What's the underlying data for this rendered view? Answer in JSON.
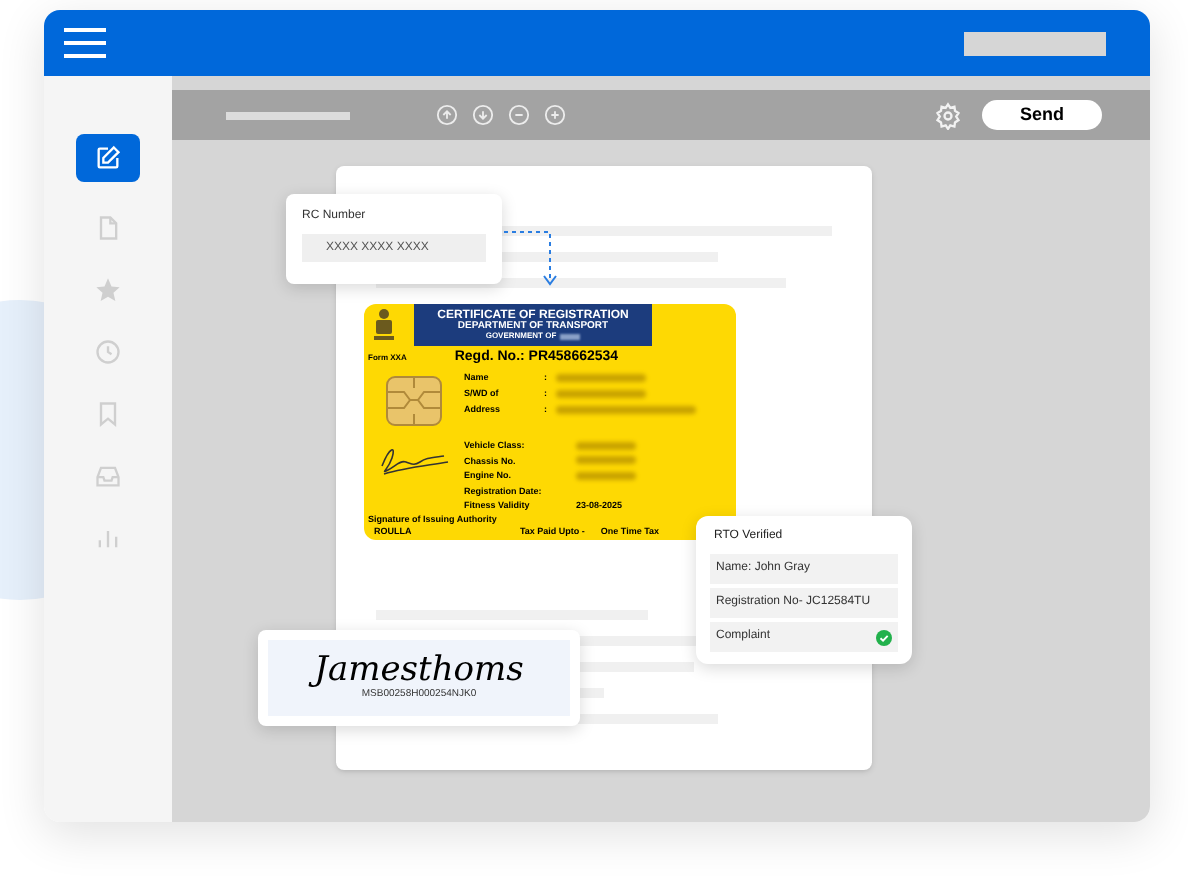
{
  "toolbar": {
    "send_button": "Send"
  },
  "sidebar": {
    "items": [
      {
        "kind": "edit",
        "selected": true
      },
      {
        "kind": "file",
        "selected": false
      },
      {
        "kind": "star",
        "selected": false
      },
      {
        "kind": "clock",
        "selected": false
      },
      {
        "kind": "bookmark",
        "selected": false
      },
      {
        "kind": "inbox",
        "selected": false
      },
      {
        "kind": "chart",
        "selected": false
      }
    ]
  },
  "rc_number": {
    "label": "RC Number",
    "value": "XXXX XXXX XXXX"
  },
  "certificate": {
    "title": "CERTIFICATE OF REGISTRATION",
    "department": "DEPARTMENT OF TRANSPORT",
    "government": "GOVERNMENT OF",
    "form": "Form XXA",
    "regd_no": "Regd. No.: PR458662534",
    "owner_fields": [
      {
        "label": "Name",
        "separator": ":"
      },
      {
        "label": "S/WD of",
        "separator": ":"
      },
      {
        "label": "Address",
        "separator": ":"
      }
    ],
    "vehicle_fields": [
      {
        "label": "Vehicle Class:",
        "blurred": true
      },
      {
        "label": "Chassis No.",
        "blurred": true
      },
      {
        "label": "Engine No.",
        "blurred": true
      },
      {
        "label": "Registration Date:",
        "blurred": false
      },
      {
        "label": "Fitness Validity",
        "value": "23-08-2025",
        "blurred": false
      }
    ],
    "signature_caption": "Signature of Issuing Authority",
    "authority": "ROULLA",
    "tax_paid": "Tax Paid Upto -",
    "tax_value": "One Time Tax"
  },
  "rto": {
    "title": "RTO Verified",
    "rows": [
      {
        "text": "Name: John Gray",
        "verified": false
      },
      {
        "text": "Registration No- JC12584TU",
        "verified": false
      },
      {
        "text": "Complaint",
        "verified": true
      }
    ]
  },
  "signature": {
    "name": "Jamesthoms",
    "code": "MSB00258H000254NJK0"
  }
}
